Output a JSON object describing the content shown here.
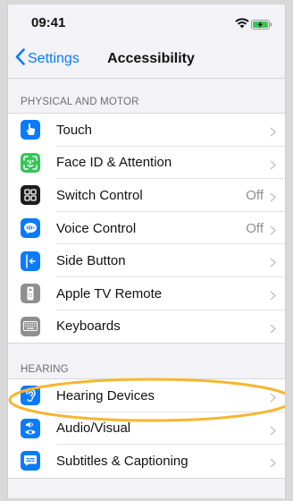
{
  "status_bar": {
    "time": "09:41"
  },
  "nav": {
    "back_label": "Settings",
    "title": "Accessibility"
  },
  "sections": [
    {
      "header": "PHYSICAL AND MOTOR",
      "items": [
        {
          "label": "Touch",
          "value": "",
          "icon": "hand-pointer-icon",
          "color": "#0a7aff"
        },
        {
          "label": "Face ID & Attention",
          "value": "",
          "icon": "face-id-icon",
          "color": "#34c759"
        },
        {
          "label": "Switch Control",
          "value": "Off",
          "icon": "switch-grid-icon",
          "color": "#1c1c1e"
        },
        {
          "label": "Voice Control",
          "value": "Off",
          "icon": "voice-bubble-icon",
          "color": "#0a7aff"
        },
        {
          "label": "Side Button",
          "value": "",
          "icon": "side-button-icon",
          "color": "#0a7aff"
        },
        {
          "label": "Apple TV Remote",
          "value": "",
          "icon": "tv-remote-icon",
          "color": "#8e8e93"
        },
        {
          "label": "Keyboards",
          "value": "",
          "icon": "keyboard-icon",
          "color": "#8e8e93"
        }
      ]
    },
    {
      "header": "HEARING",
      "items": [
        {
          "label": "Hearing Devices",
          "value": "",
          "icon": "ear-icon",
          "color": "#0a7aff"
        },
        {
          "label": "Audio/Visual",
          "value": "",
          "icon": "speaker-eye-icon",
          "color": "#0a7aff"
        },
        {
          "label": "Subtitles & Captioning",
          "value": "",
          "icon": "captions-icon",
          "color": "#0a7aff"
        }
      ]
    }
  ],
  "highlight": {
    "color": "#f5b731"
  }
}
